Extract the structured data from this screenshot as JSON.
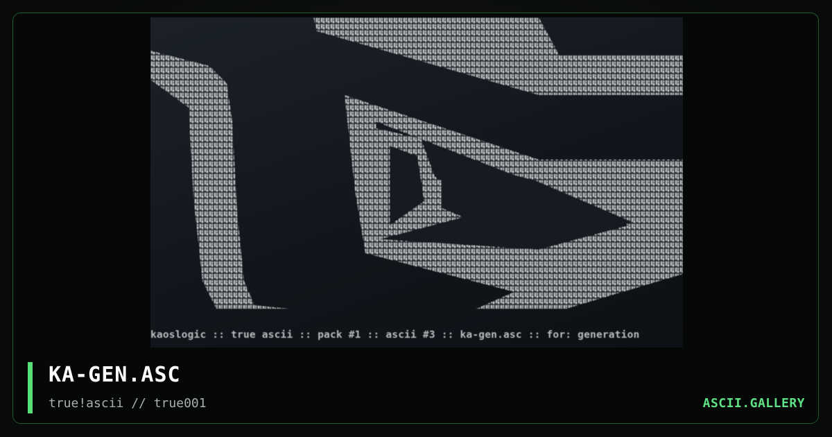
{
  "artwork": {
    "credit_line": "kaoslogic :: true ascii :: pack #1 :: ascii #3 :: ka-gen.asc :: for: generation"
  },
  "caption": {
    "title": "KA-GEN.ASC",
    "subtitle": "true!ascii // true001",
    "brand": "ASCII.GALLERY"
  },
  "colors": {
    "accent": "#57e07a",
    "brand": "#5fe285",
    "frame_border": "#1f5a2c",
    "ascii_glyph": "#c9cdd1"
  }
}
